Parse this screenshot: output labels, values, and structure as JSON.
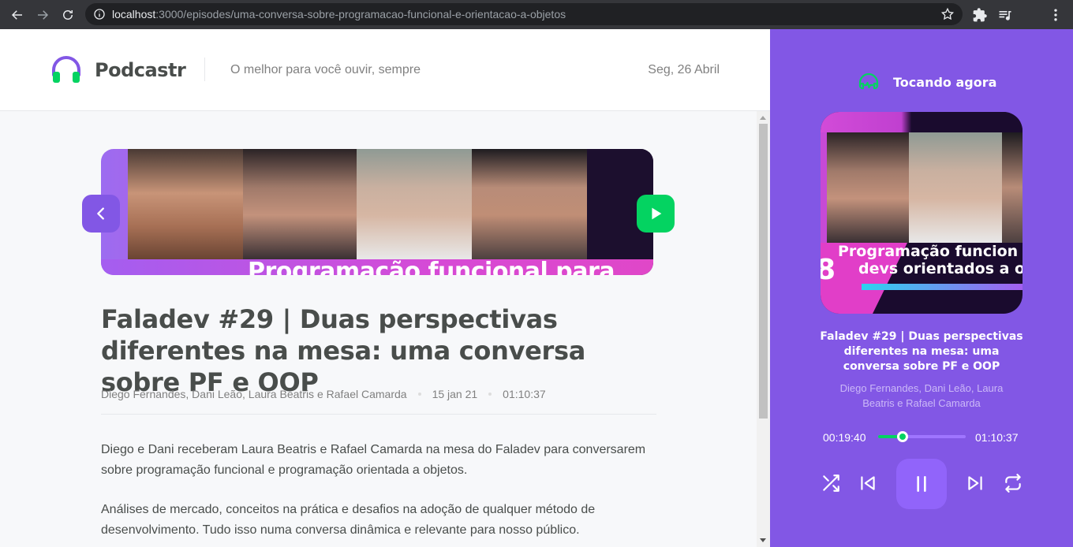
{
  "browser": {
    "url_host": "localhost",
    "url_path": ":3000/episodes/uma-conversa-sobre-programacao-funcional-e-orientacao-a-objetos"
  },
  "header": {
    "logo_text": "Podcastr",
    "tagline": "O melhor para você ouvir, sempre",
    "date": "Seg, 26 Abril"
  },
  "episode": {
    "thumbnail_caption": "Programação funcional para",
    "title": "Faladev #29 | Duas perspectivas diferentes na mesa: uma conversa sobre PF e OOP",
    "members": "Diego Fernandes, Dani Leão, Laura Beatris e Rafael Camarda",
    "published_at": "15 jan 21",
    "duration": "01:10:37",
    "description": [
      "Diego e Dani receberam Laura Beatris e Rafael Camarda na mesa do Faladev para conversarem sobre programação funcional e programação orientada a objetos.",
      "Análises de mercado, conceitos na prática e desafios na adoção de qualquer método de desenvolvimento. Tudo isso numa conversa dinâmica e relevante para nosso público."
    ]
  },
  "player": {
    "heading": "Tocando agora",
    "thumbnail_caption_1": "Programação funcion",
    "thumbnail_caption_2": "devs orientados a o",
    "thumbnail_number": "8",
    "title": "Faladev #29 | Duas perspectivas diferentes na mesa: uma conversa sobre PF e OOP",
    "members": "Diego Fernandes, Dani Leão, Laura Beatris e Rafael Camarda",
    "current_time": "00:19:40",
    "total_time": "01:10:37",
    "progress": 0.28
  },
  "colors": {
    "brand_purple": "#8257e5",
    "accent_green": "#04d361",
    "text_gray": "#494d4b"
  }
}
